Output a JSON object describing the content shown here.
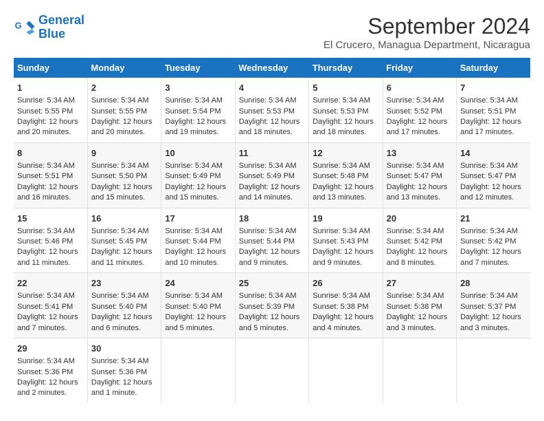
{
  "logo": {
    "line1": "General",
    "line2": "Blue"
  },
  "title": "September 2024",
  "location": "El Crucero, Managua Department, Nicaragua",
  "weekdays": [
    "Sunday",
    "Monday",
    "Tuesday",
    "Wednesday",
    "Thursday",
    "Friday",
    "Saturday"
  ],
  "weeks": [
    [
      {
        "day": "1",
        "sunrise": "5:34 AM",
        "sunset": "5:55 PM",
        "daylight": "12 hours and 20 minutes."
      },
      {
        "day": "2",
        "sunrise": "5:34 AM",
        "sunset": "5:55 PM",
        "daylight": "12 hours and 20 minutes."
      },
      {
        "day": "3",
        "sunrise": "5:34 AM",
        "sunset": "5:54 PM",
        "daylight": "12 hours and 19 minutes."
      },
      {
        "day": "4",
        "sunrise": "5:34 AM",
        "sunset": "5:53 PM",
        "daylight": "12 hours and 18 minutes."
      },
      {
        "day": "5",
        "sunrise": "5:34 AM",
        "sunset": "5:53 PM",
        "daylight": "12 hours and 18 minutes."
      },
      {
        "day": "6",
        "sunrise": "5:34 AM",
        "sunset": "5:52 PM",
        "daylight": "12 hours and 17 minutes."
      },
      {
        "day": "7",
        "sunrise": "5:34 AM",
        "sunset": "5:51 PM",
        "daylight": "12 hours and 17 minutes."
      }
    ],
    [
      {
        "day": "8",
        "sunrise": "5:34 AM",
        "sunset": "5:51 PM",
        "daylight": "12 hours and 16 minutes."
      },
      {
        "day": "9",
        "sunrise": "5:34 AM",
        "sunset": "5:50 PM",
        "daylight": "12 hours and 15 minutes."
      },
      {
        "day": "10",
        "sunrise": "5:34 AM",
        "sunset": "5:49 PM",
        "daylight": "12 hours and 15 minutes."
      },
      {
        "day": "11",
        "sunrise": "5:34 AM",
        "sunset": "5:49 PM",
        "daylight": "12 hours and 14 minutes."
      },
      {
        "day": "12",
        "sunrise": "5:34 AM",
        "sunset": "5:48 PM",
        "daylight": "12 hours and 13 minutes."
      },
      {
        "day": "13",
        "sunrise": "5:34 AM",
        "sunset": "5:47 PM",
        "daylight": "12 hours and 13 minutes."
      },
      {
        "day": "14",
        "sunrise": "5:34 AM",
        "sunset": "5:47 PM",
        "daylight": "12 hours and 12 minutes."
      }
    ],
    [
      {
        "day": "15",
        "sunrise": "5:34 AM",
        "sunset": "5:46 PM",
        "daylight": "12 hours and 11 minutes."
      },
      {
        "day": "16",
        "sunrise": "5:34 AM",
        "sunset": "5:45 PM",
        "daylight": "12 hours and 11 minutes."
      },
      {
        "day": "17",
        "sunrise": "5:34 AM",
        "sunset": "5:44 PM",
        "daylight": "12 hours and 10 minutes."
      },
      {
        "day": "18",
        "sunrise": "5:34 AM",
        "sunset": "5:44 PM",
        "daylight": "12 hours and 9 minutes."
      },
      {
        "day": "19",
        "sunrise": "5:34 AM",
        "sunset": "5:43 PM",
        "daylight": "12 hours and 9 minutes."
      },
      {
        "day": "20",
        "sunrise": "5:34 AM",
        "sunset": "5:42 PM",
        "daylight": "12 hours and 8 minutes."
      },
      {
        "day": "21",
        "sunrise": "5:34 AM",
        "sunset": "5:42 PM",
        "daylight": "12 hours and 7 minutes."
      }
    ],
    [
      {
        "day": "22",
        "sunrise": "5:34 AM",
        "sunset": "5:41 PM",
        "daylight": "12 hours and 7 minutes."
      },
      {
        "day": "23",
        "sunrise": "5:34 AM",
        "sunset": "5:40 PM",
        "daylight": "12 hours and 6 minutes."
      },
      {
        "day": "24",
        "sunrise": "5:34 AM",
        "sunset": "5:40 PM",
        "daylight": "12 hours and 5 minutes."
      },
      {
        "day": "25",
        "sunrise": "5:34 AM",
        "sunset": "5:39 PM",
        "daylight": "12 hours and 5 minutes."
      },
      {
        "day": "26",
        "sunrise": "5:34 AM",
        "sunset": "5:38 PM",
        "daylight": "12 hours and 4 minutes."
      },
      {
        "day": "27",
        "sunrise": "5:34 AM",
        "sunset": "5:38 PM",
        "daylight": "12 hours and 3 minutes."
      },
      {
        "day": "28",
        "sunrise": "5:34 AM",
        "sunset": "5:37 PM",
        "daylight": "12 hours and 3 minutes."
      }
    ],
    [
      {
        "day": "29",
        "sunrise": "5:34 AM",
        "sunset": "5:36 PM",
        "daylight": "12 hours and 2 minutes."
      },
      {
        "day": "30",
        "sunrise": "5:34 AM",
        "sunset": "5:36 PM",
        "daylight": "12 hours and 1 minute."
      },
      null,
      null,
      null,
      null,
      null
    ]
  ]
}
